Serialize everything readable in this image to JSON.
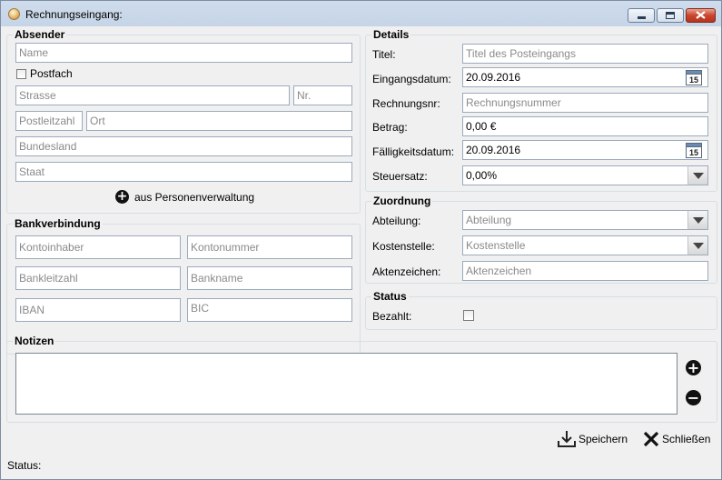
{
  "window": {
    "title": "Rechnungseingang:",
    "icon": "app-icon",
    "buttons": [
      "minimize-icon",
      "maximize-icon",
      "close-icon"
    ]
  },
  "absender": {
    "title": "Absender",
    "name_placeholder": "Name",
    "postfach_label": "Postfach",
    "strasse_placeholder": "Strasse",
    "nr_placeholder": "Nr.",
    "plz_placeholder": "Postleitzahl",
    "ort_placeholder": "Ort",
    "bundesland_placeholder": "Bundesland",
    "staat_placeholder": "Staat",
    "aus_personen_label": "aus Personenverwaltung"
  },
  "bank": {
    "title": "Bankverbindung",
    "kontoinhaber_placeholder": "Kontoinhaber",
    "kontonummer_placeholder": "Kontonummer",
    "bankleitzahl_placeholder": "Bankleitzahl",
    "bankname_placeholder": "Bankname",
    "iban_placeholder": "IBAN",
    "bic_placeholder": "BIC"
  },
  "details": {
    "title": "Details",
    "titel_label": "Titel:",
    "titel_placeholder": "Titel des Posteingangs",
    "eingangsdatum_label": "Eingangsdatum:",
    "eingangsdatum_value": "20.09.2016",
    "rechnungsnr_label": "Rechnungsnr:",
    "rechnungsnr_placeholder": "Rechnungsnummer",
    "betrag_label": "Betrag:",
    "betrag_value": "0,00 €",
    "faelligkeit_label": "Fälligkeitsdatum:",
    "faelligkeit_value": "20.09.2016",
    "steuersatz_label": "Steuersatz:",
    "steuersatz_value": "0,00%",
    "calendar_day": "15"
  },
  "zuordnung": {
    "title": "Zuordnung",
    "abteilung_label": "Abteilung:",
    "abteilung_placeholder": "Abteilung",
    "kostenstelle_label": "Kostenstelle:",
    "kostenstelle_placeholder": "Kostenstelle",
    "aktenzeichen_label": "Aktenzeichen:",
    "aktenzeichen_placeholder": "Aktenzeichen"
  },
  "status_group": {
    "title": "Status",
    "bezahlt_label": "Bezahlt:"
  },
  "notizen": {
    "title": "Notizen"
  },
  "footer": {
    "speichern_label": "Speichern",
    "schliessen_label": "Schließen",
    "status_label": "Status:"
  }
}
